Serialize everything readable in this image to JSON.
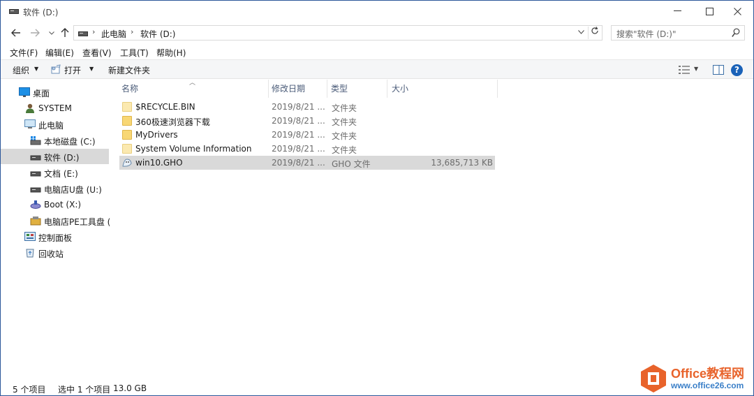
{
  "window": {
    "title": "软件 (D:)",
    "controls": {
      "minimize": "—",
      "maximize": "☐",
      "close": "✕"
    }
  },
  "address": {
    "crumbs": [
      "此电脑",
      "软件 (D:)"
    ],
    "search_placeholder": "搜索\"软件 (D:)\""
  },
  "menu": [
    "文件(F)",
    "编辑(E)",
    "查看(V)",
    "工具(T)",
    "帮助(H)"
  ],
  "toolbar": {
    "organize": "组织",
    "open": "打开",
    "new_folder": "新建文件夹",
    "help": "?"
  },
  "nav": [
    {
      "label": "桌面",
      "icon": "desktop-icon"
    },
    {
      "label": "SYSTEM",
      "icon": "user-icon"
    },
    {
      "label": "此电脑",
      "icon": "computer-icon"
    },
    {
      "label": "本地磁盘 (C:)",
      "icon": "windows-drive-icon"
    },
    {
      "label": "软件 (D:)",
      "icon": "drive-icon",
      "selected": true
    },
    {
      "label": "文档 (E:)",
      "icon": "drive-icon"
    },
    {
      "label": "电脑店U盘 (U:)",
      "icon": "drive-icon"
    },
    {
      "label": "Boot (X:)",
      "icon": "boot-drive-icon"
    },
    {
      "label": "电脑店PE工具盘 (",
      "icon": "pe-drive-icon"
    },
    {
      "label": "控制面板",
      "icon": "control-panel-icon"
    },
    {
      "label": "回收站",
      "icon": "recycle-bin-icon"
    }
  ],
  "columns": {
    "name": "名称",
    "date": "修改日期",
    "type": "类型",
    "size": "大小"
  },
  "files": [
    {
      "name": "$RECYCLE.BIN",
      "date": "2019/8/21 ...",
      "type": "文件夹",
      "size": "",
      "icon": "folder-icon"
    },
    {
      "name": "360极速浏览器下载",
      "date": "2019/8/21 ...",
      "type": "文件夹",
      "size": "",
      "icon": "folder-icon"
    },
    {
      "name": "MyDrivers",
      "date": "2019/8/21 ...",
      "type": "文件夹",
      "size": "",
      "icon": "folder-icon"
    },
    {
      "name": "System Volume Information",
      "date": "2019/8/21 ...",
      "type": "文件夹",
      "size": "",
      "icon": "folder-icon"
    },
    {
      "name": "win10.GHO",
      "date": "2019/8/21 ...",
      "type": "GHO 文件",
      "size": "13,685,713 KB",
      "icon": "gho-file-icon",
      "selected": true
    }
  ],
  "status": {
    "count": "5 个项目",
    "selected": "选中 1 个项目",
    "size": "13.0 GB"
  },
  "watermark": {
    "title": "Office教程网",
    "url": "www.office26.com",
    "brand_color": "#e8632b",
    "url_color": "#3a7fc8"
  }
}
